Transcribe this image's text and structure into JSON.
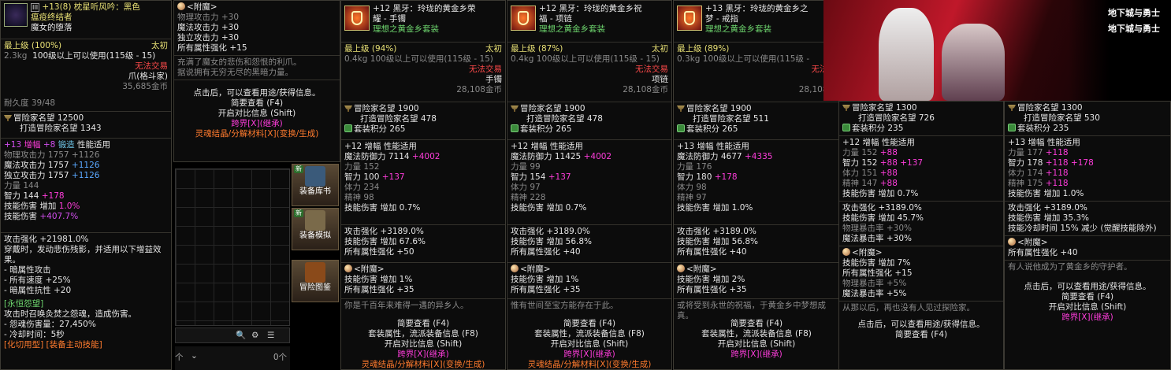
{
  "p1": {
    "badge": "III",
    "title1": "+13(8) 枕星听风吟：黑色",
    "title2": "瘟疫终结者",
    "sub": "魔女的堕落",
    "grade": "最上级",
    "pct": "(100%)",
    "tier": "太初",
    "weight": "2.3kg",
    "req": "100级以上可以使用(115级 - 15)",
    "notrade": "无法交易",
    "type": "爪(格斗家)",
    "price": "35,685金币",
    "dur": "耐久度 39/48",
    "rep": "冒险家名望 12500",
    "rep2": "打造冒险家名望 1343",
    "amp": "+13",
    "amp2": "增幅",
    "amp3": "+8",
    "amp4": "锻造",
    "amp5": "性能适用",
    "s1": "物理攻击力 1757 +1126",
    "s2": "魔法攻击力 1757",
    "s2v": "+1126",
    "s3": "独立攻击力 1757",
    "s3v": "+1126",
    "s4": "力量 144",
    "s5": "智力 144",
    "s5v": "+178",
    "s6": "技能伤害 增加",
    "s6v": "1.0%",
    "s7": "技能伤害",
    "s7v": "+407.7%",
    "e1": "攻击强化 +21981.0%",
    "e2": "穿戴时，发动悲伤残影，并适用以下增益效果。",
    "e3": "- 暗属性攻击",
    "e4": "- 所有速度 +25%",
    "e5": "- 暗属性抗性 +20",
    "f1": "[永恒怨望]",
    "f2": "攻击时召唤灸焚之怨魂，造成伤害。",
    "f3": "- 怨魂伤害量：27,450%",
    "f4": "- 冷却时间：5秒",
    "f5": "[化切用型] [装备主动技能]"
  },
  "p2": {
    "hdr": "<附魔>",
    "a": "物理攻击力 +30",
    "b": "魔法攻击力 +30",
    "c": "独立攻击力 +30",
    "d": "所有属性强化 +15",
    "lore": "充满了魔女的悲伤和怨恨的利爪。",
    "lore2": "据说拥有无穷无尽的黑暗力量。",
    "h1": "点击后，可以查看用途/获得信息。",
    "h2": "简要查看 (F4)",
    "h3": "开启对比信息 (Shift)",
    "h4": "跨界[X](继承)",
    "h5": "灵魂结晶/分解材料[X](变换/生成)"
  },
  "side": {
    "new": "新",
    "b1": "装备库",
    "b2": "装备模拟",
    "b3": "冒险图鉴",
    "tail": "书",
    "cnt1": "个",
    "cnt2": "0个"
  },
  "acc": [
    {
      "t1": "+12 黑牙：玲珑的黄金乡荣",
      "t2": "耀 - 手镯",
      "t3": "理想之黄金乡套装",
      "grade": "最上级",
      "pct": "(94%)",
      "tier": "太初",
      "w": "0.4kg",
      "req": "100级以上可以使用(115级 - 15)",
      "nt": "无法交易",
      "type": "手镯",
      "price": "28,108金币",
      "rep": "冒险家名望 1900",
      "rep2": "打造冒险家名望 478",
      "set": "套装积分 265",
      "amp": "+12 增幅 性能适用",
      "s1": "魔法防御力 7114",
      "s1v": "+4002",
      "s2": "力量 152",
      "s3": "智力 100",
      "s3v": "+137",
      "s4": "体力 234",
      "s5": "精神 98",
      "s6": "技能伤害 增加 0.7%",
      "e1": "攻击强化 +3189.0%",
      "e2": "技能伤害 增加 67.6%",
      "e3": "所有属性强化 +50",
      "enh": "<附魔>",
      "en1": "技能伤害 增加 1%",
      "en2": "所有属性强化 +35",
      "lore": "你是千百年来难得一遇的异乡人。",
      "h1": "",
      "h2": "简要查看 (F4)",
      "h3": "套装属性，流派装备信息 (F8)",
      "h4": "开启对比信息 (Shift)",
      "h5": "跨界[X](继承)",
      "h6": "灵魂结晶/分解材料[X](变换/生成)"
    },
    {
      "t1": "+12 黑牙：玲珑的黄金乡祝",
      "t2": "福 - 项链",
      "t3": "理想之黄金乡套装",
      "grade": "最上级",
      "pct": "(87%)",
      "tier": "太初",
      "w": "0.4kg",
      "req": "100级以上可以使用(115级 - 15)",
      "nt": "无法交易",
      "type": "项链",
      "price": "28,108金币",
      "rep": "冒险家名望 1900",
      "rep2": "打造冒险家名望 478",
      "set": "套装积分 265",
      "amp": "+12 增幅 性能适用",
      "s1": "魔法防御力 11425",
      "s1v": "+4002",
      "s2": "力量 99",
      "s3": "智力 154",
      "s3v": "+137",
      "s4": "体力 97",
      "s5": "精神 228",
      "s6": "技能伤害 增加 0.7%",
      "e1": "攻击强化 +3189.0%",
      "e2": "技能伤害 增加 56.8%",
      "e3": "所有属性强化 +40",
      "enh": "<附魔>",
      "en1": "技能伤害 增加 1%",
      "en2": "所有属性强化 +35",
      "lore": "惟有世间至宝方能存在于此。",
      "h1": "",
      "h2": "简要查看 (F4)",
      "h3": "套装属性，流派装备信息 (F8)",
      "h4": "开启对比信息 (Shift)",
      "h5": "跨界[X](继承)",
      "h6": "灵魂结晶/分解材料[X](变换/生成)"
    },
    {
      "t1": "+13 黑牙：玲珑的黄金乡之",
      "t2": "梦 - 戒指",
      "t3": "理想之黄金乡套装",
      "grade": "最上级",
      "pct": "(89%)",
      "tier": "太",
      "w": "0.3kg",
      "req": "100级以上可以使用(115级 -",
      "nt": "无法交",
      "type": "戒",
      "price": "28,108金",
      "rep": "冒险家名望 1900",
      "rep2": "打造冒险家名望 511",
      "set": "套装积分 265",
      "amp": "+13 增幅 性能适用",
      "s1": "魔法防御力 4677",
      "s1v": "+4335",
      "s2": "力量 176",
      "s3": "智力 180",
      "s3v": "+178",
      "s4": "体力 98",
      "s5": "精神 97",
      "s6": "技能伤害 增加 1.0%",
      "e1": "攻击强化 +3189.0%",
      "e2": "技能伤害 增加 56.8%",
      "e3": "所有属性强化 +40",
      "enh": "<附魔>",
      "en1": "技能伤害 增加 2%",
      "en2": "所有属性强化 +35",
      "lore": "或将受到永世的祝福，于黄金乡中梦想成真。",
      "h1": "",
      "h2": "简要查看 (F4)",
      "h3": "套装属性，流派装备信息 (F8)",
      "h4": "开启对比信息 (Shift)",
      "h5": "跨界[X](继承)",
      "h6": ""
    }
  ],
  "p6": {
    "rep": "冒险家名望 1300",
    "rep2": "打造冒险家名望 726",
    "set": "套装积分 235",
    "amp": "+12 增幅 性能适用",
    "s1": "力量 152",
    "s1v": "+88",
    "s2": "智力 152",
    "s2v": "+88 +137",
    "s3": "体力 151",
    "s3v": "+88",
    "s4": "精神 147",
    "s4v": "+88",
    "s5": "技能伤害 增加 0.7%",
    "e1": "攻击强化 +3189.0%",
    "e2": "技能伤害 增加 45.7%",
    "e3": "物理暴击率 +30%",
    "e4": "魔法暴击率 +30%",
    "enh": "<附魔>",
    "en1": "技能伤害 增加 7%",
    "en2": "所有属性强化 +15",
    "en3": "物理暴击率 +5%",
    "en4": "魔法暴击率 +5%",
    "lore": "从那以后，再也没有人见过探险家。",
    "h1": "点击后，可以查看用途/获得信息。",
    "h2": "简要查看 (F4)"
  },
  "p7": {
    "rep": "冒险家名望 1300",
    "rep2": "打造冒险家名望 530",
    "set": "套装积分 235",
    "amp": "+13 增幅 性能适用",
    "s1": "力量 177",
    "s1v": "+118",
    "s2": "智力 178",
    "s2v": "+118 +178",
    "s3": "体力 174",
    "s3v": "+118",
    "s4": "精神 175",
    "s4v": "+118",
    "s5": "技能伤害 增加 1.0%",
    "e1": "攻击强化 +3189.0%",
    "e2": "技能伤害 增加 35.3%",
    "e3": "技能冷却时间 15% 减少 (觉醒技能除外)",
    "enh": "<附魔>",
    "en1": "所有属性强化 +40",
    "lore": "有人说他成为了黄金乡的守护者。",
    "h1": "点击后，可以查看用途/获得信息。",
    "h2": "简要查看 (F4)",
    "h3": "开启对比信息 (Shift)",
    "h4": "跨界[X](继承)"
  },
  "hero": {
    "logo": "地下城与勇士"
  }
}
